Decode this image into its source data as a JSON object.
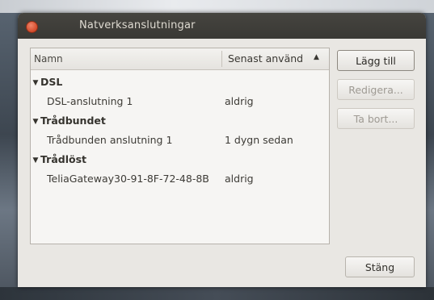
{
  "window": {
    "title": "Natverksanslutningar"
  },
  "list": {
    "columns": {
      "name": "Namn",
      "last_used": "Senast använd",
      "sort_indicator": "▲"
    },
    "groups": [
      {
        "label": "DSL",
        "items": [
          {
            "name": "DSL-anslutning 1",
            "last_used": "aldrig"
          }
        ]
      },
      {
        "label": "Trådbundet",
        "items": [
          {
            "name": "Trådbunden anslutning 1",
            "last_used": "1 dygn sedan"
          }
        ]
      },
      {
        "label": "Trådlöst",
        "items": [
          {
            "name": "TeliaGateway30-91-8F-72-48-8B",
            "last_used": "aldrig"
          }
        ]
      }
    ],
    "expander_glyph": "▼"
  },
  "buttons": {
    "add": "Lägg till",
    "edit": "Redigera...",
    "delete": "Ta bort...",
    "close": "Stäng"
  },
  "icons": {
    "close": "close-icon",
    "expander": "triangle-down-icon"
  },
  "colors": {
    "titlebar": "#3c3b37",
    "close_button": "#df5a3a",
    "window_bg": "#e9e7e3"
  }
}
